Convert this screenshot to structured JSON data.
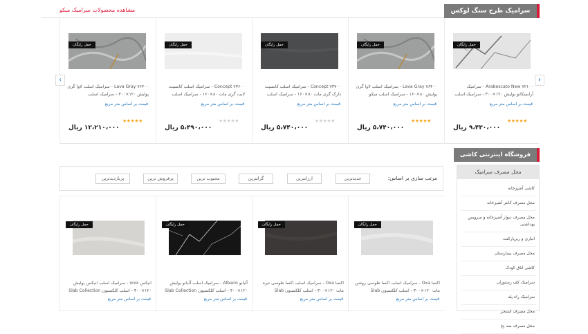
{
  "section1": {
    "title": "سرامیک طرح سنگ لوکس میکو",
    "view_all": "مشاهده محصولات سرامیک میکو"
  },
  "carousel": {
    "prev_icon": "chevron-left-icon",
    "next_icon": "chevron-right-icon",
    "products": [
      {
        "badge": "حمل رایگان",
        "title": "Lava Gray ۷۶۴۰۰ - سرامیک اسلب لاوا گری پولیش ۱۲۰×۳۰۰ - سرامیک اسلب",
        "price_note": "قیمت بر اساس متر مربع",
        "rating": 5,
        "price": "۱۲،۲۱۰،۰۰۰ ریال",
        "tile": "#9ea0a0"
      },
      {
        "badge": "حمل رایگان",
        "title": "Concept ۷۳۶۰۰ - سرامیک اسلب کانسپت لایت گری مات ۸۰×۱۶۰ - سرامیک اسلب",
        "price_note": "قیمت بر اساس متر مربع",
        "rating": 0,
        "price": "۵،۴۹۰،۰۰۰ ریال",
        "tile": "#eeeeee"
      },
      {
        "badge": "حمل رایگان",
        "title": "Concept ۷۳۷۰۰ - سرامیک اسلب کانسپت دارک گری مات ۸۰×۱۶۰ - سرامیک اسلب",
        "price_note": "قیمت بر اساس متر مربع",
        "rating": 0,
        "price": "۵،۷۴۰،۰۰۰ ریال",
        "tile": "#4b4c4d"
      },
      {
        "badge": "حمل رایگان",
        "title": "Lava Gray ۷۶۴۰۰ - سرامیک اسلب لاوا گری پولیش ۸۰×۱۶۰ - سرامیک اسلب میکو",
        "price_note": "قیمت بر اساس متر مربع",
        "rating": 5,
        "price": "۵،۷۴۰،۰۰۰ ریال",
        "tile": "#9ea0a0"
      },
      {
        "badge": "حمل رایگان",
        "title": "Arabescato New ۷۲۱۰۰ - سرامیک آرابسکاتو پولیش ۱۲۰×۳۰۰ - سرامیک اسلب میکو",
        "price_note": "قیمت بر اساس متر مربع",
        "rating": 5,
        "price": "۹،۴۳۰،۰۰۰ ریال",
        "tile": "#e4e4e4"
      }
    ]
  },
  "sidebar": {
    "shop_title": "فروشگاه اینترنتی کاشی سرامیک",
    "category_title": "محل مصرف سرامیک",
    "items": [
      "کاشی آشپزخانه",
      "محل مصرف کانتر آشپزخانه",
      "محل مصرف دیوار آشپزخانه و سرویس بهداشتی",
      "انباری و زیرپارکنت",
      "محل مصرف بیمارستان",
      "کاشی اتاق کودک",
      "سرامیک کف رستوران",
      "سرامیک راه پله",
      "محل مصرف استخر",
      "محل مصرف ضد یخ"
    ]
  },
  "sort": {
    "label": "مرتب سازی بر اساس:",
    "options": [
      "جدیدترین",
      "ارزانترین",
      "گرانترین",
      "محبوب ترین",
      "پرفروش ترین",
      "پربازدیدترین"
    ]
  },
  "grid": {
    "products": [
      {
        "badge": "حمل رایگان",
        "title": "اکسا Oxa - سرامیک اسلب اکسا طوسی روشن مات ۱۲۰×۳۰۰ - اسلب کلکسیون Slab",
        "price_note": "قیمت بر اساس متر مربع",
        "tile": "#dcdcdc"
      },
      {
        "badge": "حمل رایگان",
        "title": "اکسا Oxa - سرامیک اسلب اکسا طوسی تیره مات ۱۲۰×۳۰۰ - اسلب کلکسیون Slab",
        "price_note": "قیمت بر اساس متر مربع",
        "tile": "#3c3837"
      },
      {
        "badge": "حمل رایگان",
        "title": "آلبانو Albano - سرامیک اسلب آلبانو پولیش ۱۲۰×۳۰۰ - اسلب کلکسیون Slab Collection",
        "price_note": "قیمت بر اساس متر مربع",
        "tile": "#151515"
      },
      {
        "badge": "حمل رایگان",
        "title": "انیکس onix - سرامیک اسلب انیکس پولیش ۱۲۰×۳۰۰ - اسلب کلکسیون Slab Collection",
        "price_note": "قیمت بر اساس متر مربع",
        "tile": "#d6d4d0"
      }
    ]
  }
}
